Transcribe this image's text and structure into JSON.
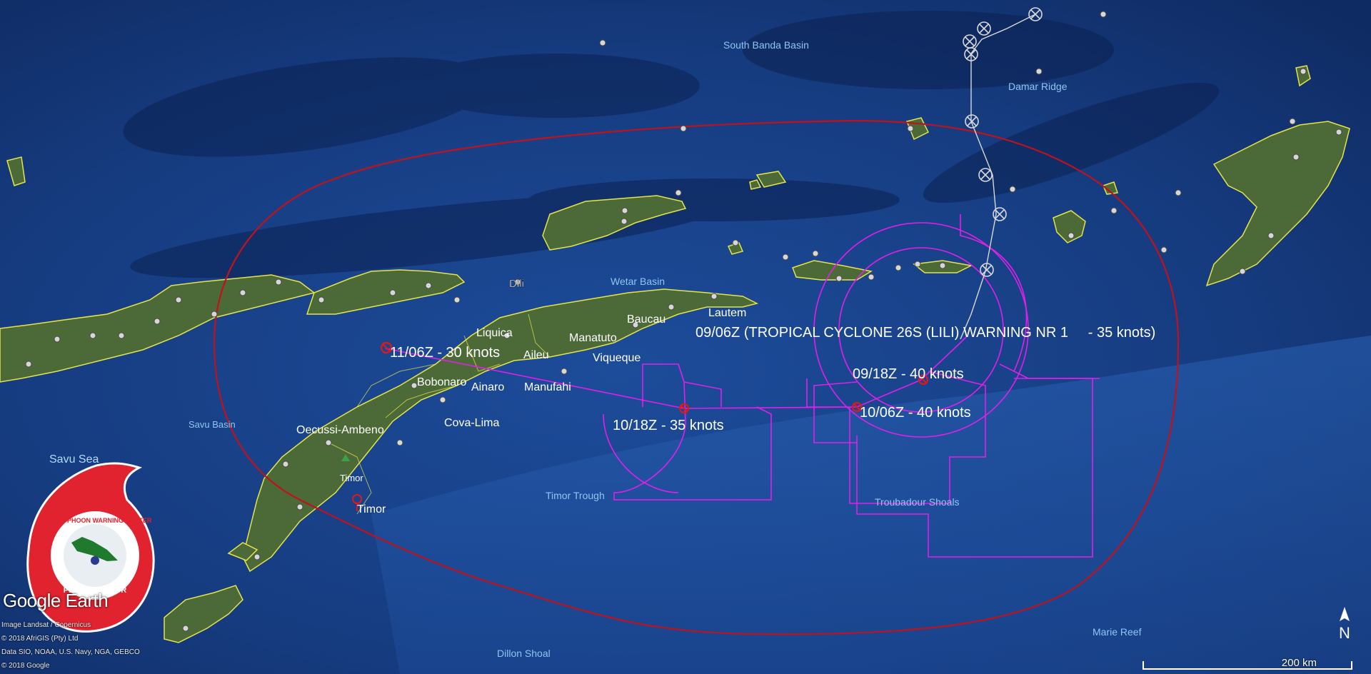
{
  "warning_title": "09/06Z (TROPICAL CYCLONE 26S (LILI) WARNING NR 1     - 35 knots)",
  "forecast_points": [
    {
      "label": "09/18Z - 40 knots"
    },
    {
      "label": "10/06Z - 40 knots"
    },
    {
      "label": "10/18Z - 35 knots"
    },
    {
      "label": "11/06Z - 30 knots"
    }
  ],
  "places": {
    "south_banda_basin": "South Banda Basin",
    "damar_ridge": "Damar Ridge",
    "wetar_basin": "Wetar Basin",
    "dili": "Dili",
    "baucau": "Baucau",
    "lautem": "Lautem",
    "liquica": "Liquica",
    "manatuto": "Manatuto",
    "aileu": "Aileu",
    "viqueque": "Viqueque",
    "bobonaro": "Bobonaro",
    "ainaro": "Ainaro",
    "manufahi": "Manufahi",
    "cova_lima": "Cova-Lima",
    "oecussi": "Oecussi-Ambeno",
    "savu_basin": "Savu Basin",
    "savu_sea": "Savu Sea",
    "timor_peak": "Timor",
    "timor": "Timor",
    "timor_trough": "Timor Trough",
    "troubadour": "Troubadour Shoals",
    "marie_reef": "Marie Reef",
    "dillon_shoal": "Dillon Shoal"
  },
  "logo": {
    "text_top": "JOINT TYPHOON WARNING CENTER",
    "text_bottom": "PEARL HARBOR"
  },
  "branding": "Google Earth",
  "attribution": [
    "Image Landsat / Copernicus",
    "© 2018 AfriGIS (Pty) Ltd",
    "Data SIO, NOAA, U.S. Navy, NGA, GEBCO",
    "© 2018 Google"
  ],
  "scale_label": "200 km",
  "north_label": "N",
  "colors": {
    "ocean": "#173f86",
    "land": "#4d6a3a",
    "coast": "#e6e34a",
    "danger_area": "#c0121c",
    "wind_radii": "#e020e8",
    "track": "#d8d8d8"
  }
}
